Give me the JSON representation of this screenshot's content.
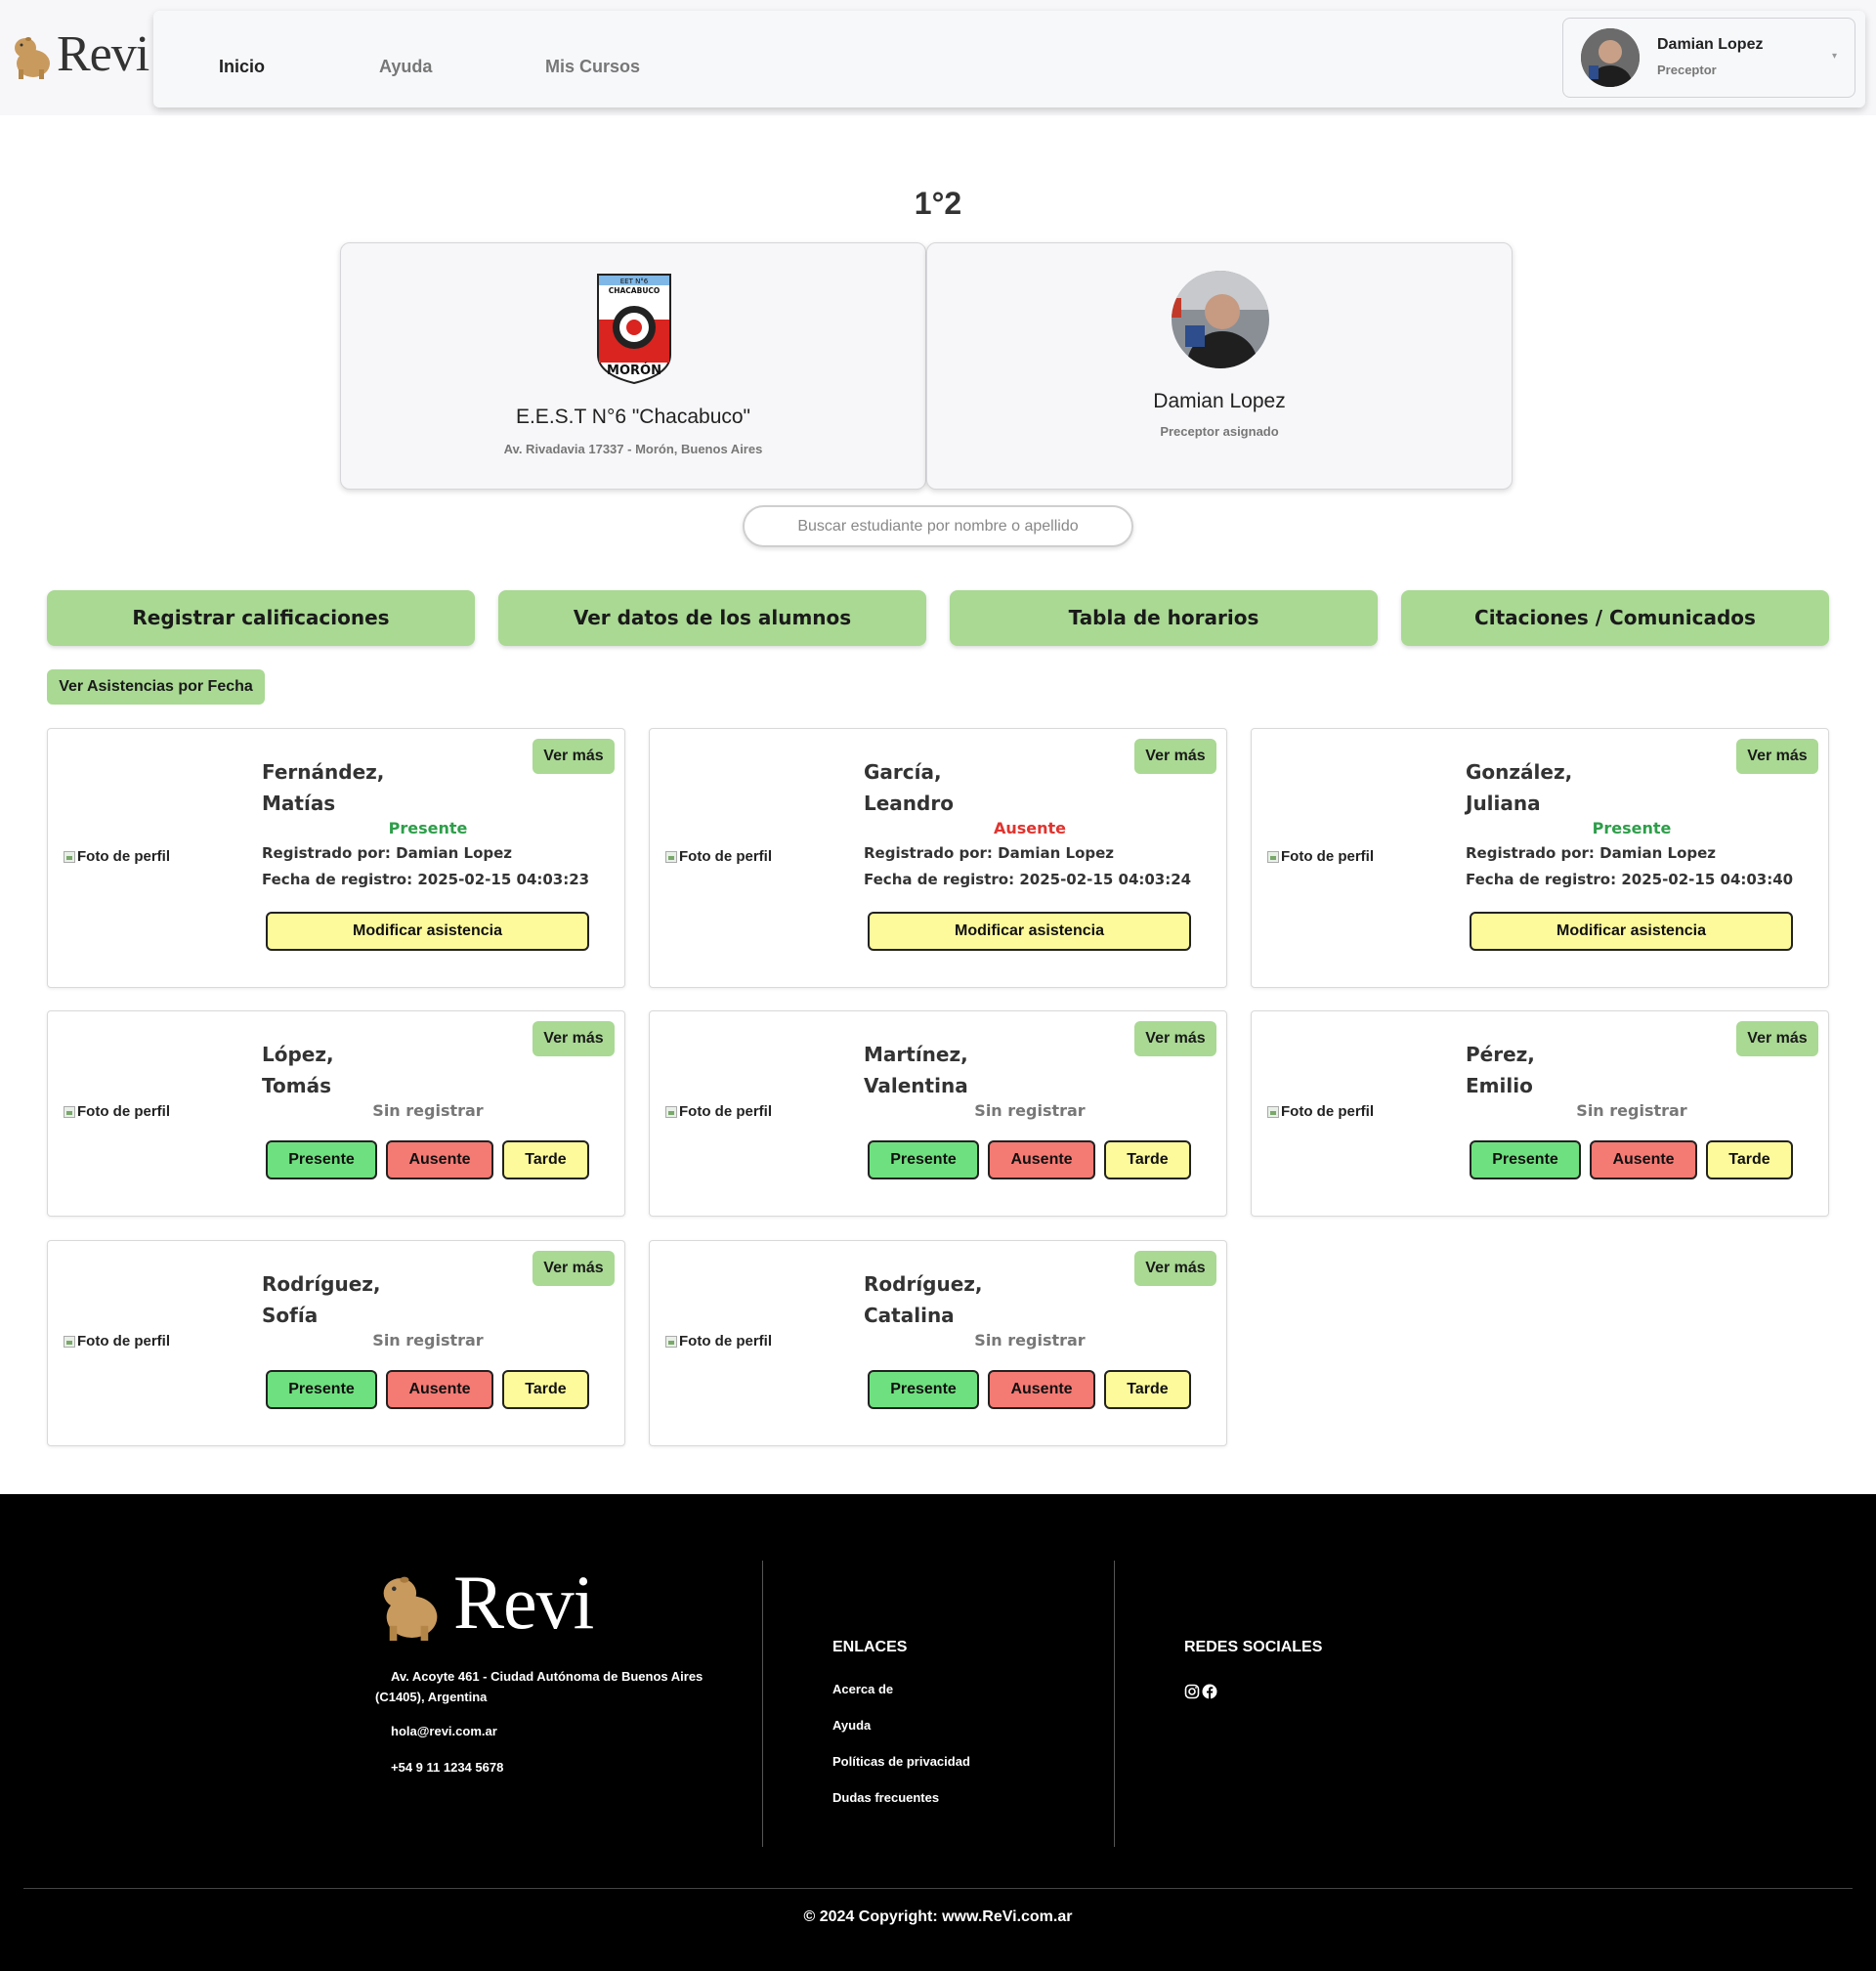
{
  "brand": {
    "name": "Revi"
  },
  "nav": {
    "links": [
      "Inicio",
      "Ayuda",
      "Mis Cursos"
    ],
    "user": {
      "name": "Damian Lopez",
      "role": "Preceptor"
    }
  },
  "course": {
    "title": "1°2"
  },
  "school": {
    "badge_top": "EET N°6",
    "badge_mid": "CHACABUCO",
    "badge_bottom": "MORÓN",
    "name": "E.E.S.T N°6 \"Chacabuco\"",
    "address": "Av. Rivadavia 17337 - Morón, Buenos Aires"
  },
  "preceptor": {
    "name": "Damian Lopez",
    "role": "Preceptor asignado"
  },
  "search": {
    "placeholder": "Buscar estudiante por nombre o apellido"
  },
  "actions": [
    "Registrar calificaciones",
    "Ver datos de los alumnos",
    "Tabla de horarios",
    "Citaciones / Comunicados"
  ],
  "attendance_by_date": "Ver Asistencias por Fecha",
  "card_labels": {
    "photo_alt": "Foto de perfil",
    "ver_mas": "Ver más",
    "modify": "Modificar asistencia",
    "present": "Presente",
    "absent": "Ausente",
    "late": "Tarde"
  },
  "students": [
    {
      "last": "Fernández,",
      "first": "Matías",
      "status": "Presente",
      "registered_by": "Registrado por: Damian Lopez",
      "date": "Fecha de registro: 2025-02-15 04:03:23"
    },
    {
      "last": "García,",
      "first": "Leandro",
      "status": "Ausente",
      "registered_by": "Registrado por: Damian Lopez",
      "date": "Fecha de registro: 2025-02-15 04:03:24"
    },
    {
      "last": "González,",
      "first": "Juliana",
      "status": "Presente",
      "registered_by": "Registrado por: Damian Lopez",
      "date": "Fecha de registro: 2025-02-15 04:03:40"
    },
    {
      "last": "López,",
      "first": "Tomás",
      "status": "Sin registrar"
    },
    {
      "last": "Martínez,",
      "first": "Valentina",
      "status": "Sin registrar"
    },
    {
      "last": "Pérez,",
      "first": "Emilio",
      "status": "Sin registrar"
    },
    {
      "last": "Rodríguez,",
      "first": "Sofía",
      "status": "Sin registrar"
    },
    {
      "last": "Rodríguez,",
      "first": "Catalina",
      "status": "Sin registrar"
    }
  ],
  "footer": {
    "address": "Av. Acoyte 461 - Ciudad Autónoma de Buenos Aires (C1405), Argentina",
    "email": "hola@revi.com.ar",
    "phone": "+54 9 11 1234 5678",
    "links_title": "ENLACES",
    "links": [
      "Acerca de",
      "Ayuda",
      "Políticas de privacidad",
      "Dudas frecuentes"
    ],
    "social_title": "REDES SOCIALES",
    "social_icons": [
      "instagram-icon",
      "facebook-icon"
    ],
    "copyright": "© 2024 Copyright: www.ReVi.com.ar"
  },
  "colors": {
    "accent_green": "#a9d993",
    "present": "#2e9e4a",
    "absent": "#e0342f",
    "modify_yellow": "#fdfa9b",
    "btn_present": "#6fe07f",
    "btn_absent": "#f47a74",
    "footer_bg": "#000000"
  }
}
